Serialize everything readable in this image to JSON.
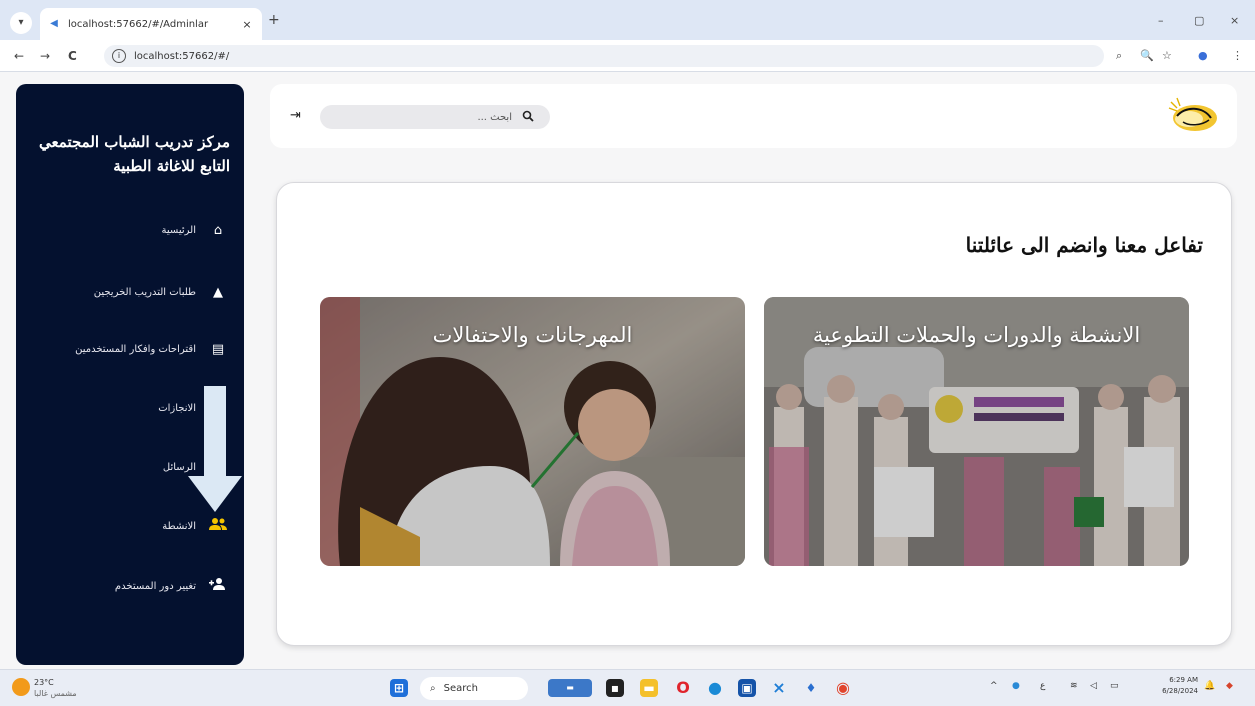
{
  "browser": {
    "tab_title": "localhost:57662/#/Adminlar",
    "tab_close": "×",
    "new_tab": "+",
    "address": "localhost:57662/#/",
    "back": "←",
    "forward": "→",
    "reload": "C",
    "minimize": "–",
    "maximize": "▢",
    "close": "×"
  },
  "sidebar": {
    "brand_line1": "مركز تدريب الشباب المجتمعي",
    "brand_line2": "التابع للاغاثة الطبية",
    "items": [
      {
        "label": "الرئيسية",
        "icon": "home-icon",
        "glyph": "⌂"
      },
      {
        "label": "طلبات التدريب الخريجين",
        "icon": "graduation-cap-icon",
        "glyph": "🎓"
      },
      {
        "label": "اقتراحات وافكار المستخدمين",
        "icon": "comment-icon",
        "glyph": "▤"
      },
      {
        "label": "الانجازات",
        "icon": "",
        "glyph": ""
      },
      {
        "label": "الرسائل",
        "icon": "",
        "glyph": ""
      },
      {
        "label": "الانشطة",
        "icon": "users-icon",
        "glyph": "👥"
      },
      {
        "label": "تغيير دور المستخدم",
        "icon": "user-plus-icon",
        "glyph": "👤+"
      }
    ]
  },
  "topbar": {
    "search_placeholder": "ابحث ...",
    "logout_glyph": "⇥"
  },
  "main": {
    "headline": "تفاعل معنا وانضم الى عائلتنا",
    "tiles": [
      {
        "caption": "المهرجانات والاحتفالات"
      },
      {
        "caption": "الانشطة والدورات والحملات التطوعية"
      }
    ]
  },
  "taskbar": {
    "temperature": "23°C",
    "weather_text": "مشمس غالبا",
    "search_label": "Search",
    "time": "6:29 AM",
    "date": "6/28/2024"
  },
  "colors": {
    "sidebar_bg": "#04112f",
    "accent_yellow": "#f5c400",
    "chrome_bg": "#dee7f5"
  }
}
